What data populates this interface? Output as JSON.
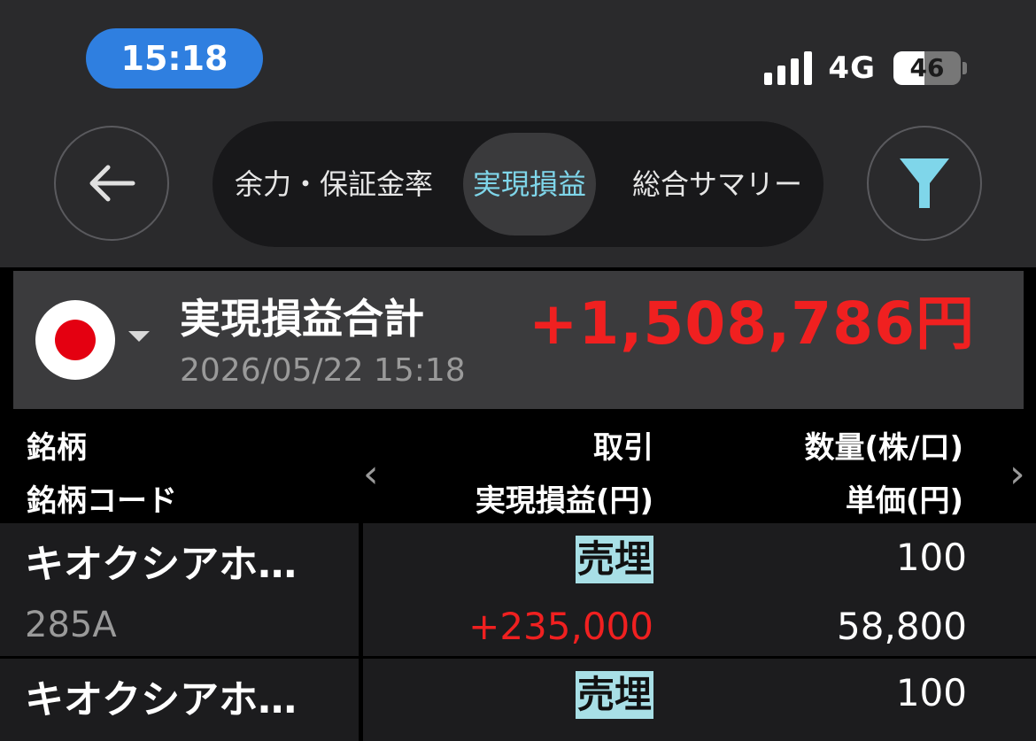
{
  "status_bar": {
    "time": "15:18",
    "network": "4G",
    "battery": "46",
    "battery_fraction": 0.46
  },
  "nav": {
    "back_icon": "arrow-left-icon",
    "filter_icon": "filter-funnel-icon",
    "tabs": [
      {
        "label": "余力・保証金率",
        "selected": false
      },
      {
        "label": "実現損益",
        "selected": true
      },
      {
        "label": "総合サマリー",
        "selected": false
      }
    ]
  },
  "summary": {
    "market_flag": "japan-flag-icon",
    "title": "実現損益合計",
    "date": "2026/05/22 15:18",
    "total": "+1,508,786円"
  },
  "table": {
    "headers": {
      "col1_line1": "銘柄",
      "col1_line2": "銘柄コード",
      "col2_line1": "取引",
      "col2_line2": "実現損益(円)",
      "col3_line1": "数量(株/口)",
      "col3_line2": "単価(円)"
    },
    "rows": [
      {
        "name": "キオクシアホ…",
        "code": "285A",
        "trade": "売埋",
        "pnl": "+235,000",
        "qty": "100",
        "price": "58,800"
      },
      {
        "name": "キオクシアホ…",
        "code": "",
        "trade": "売埋",
        "pnl": "",
        "qty": "100",
        "price": ""
      }
    ]
  },
  "colors": {
    "accent_blue": "#2f7fe0",
    "selected_tab_text": "#7fd6ea",
    "profit_red": "#f02020",
    "trade_highlight": "#a8dfe6"
  }
}
